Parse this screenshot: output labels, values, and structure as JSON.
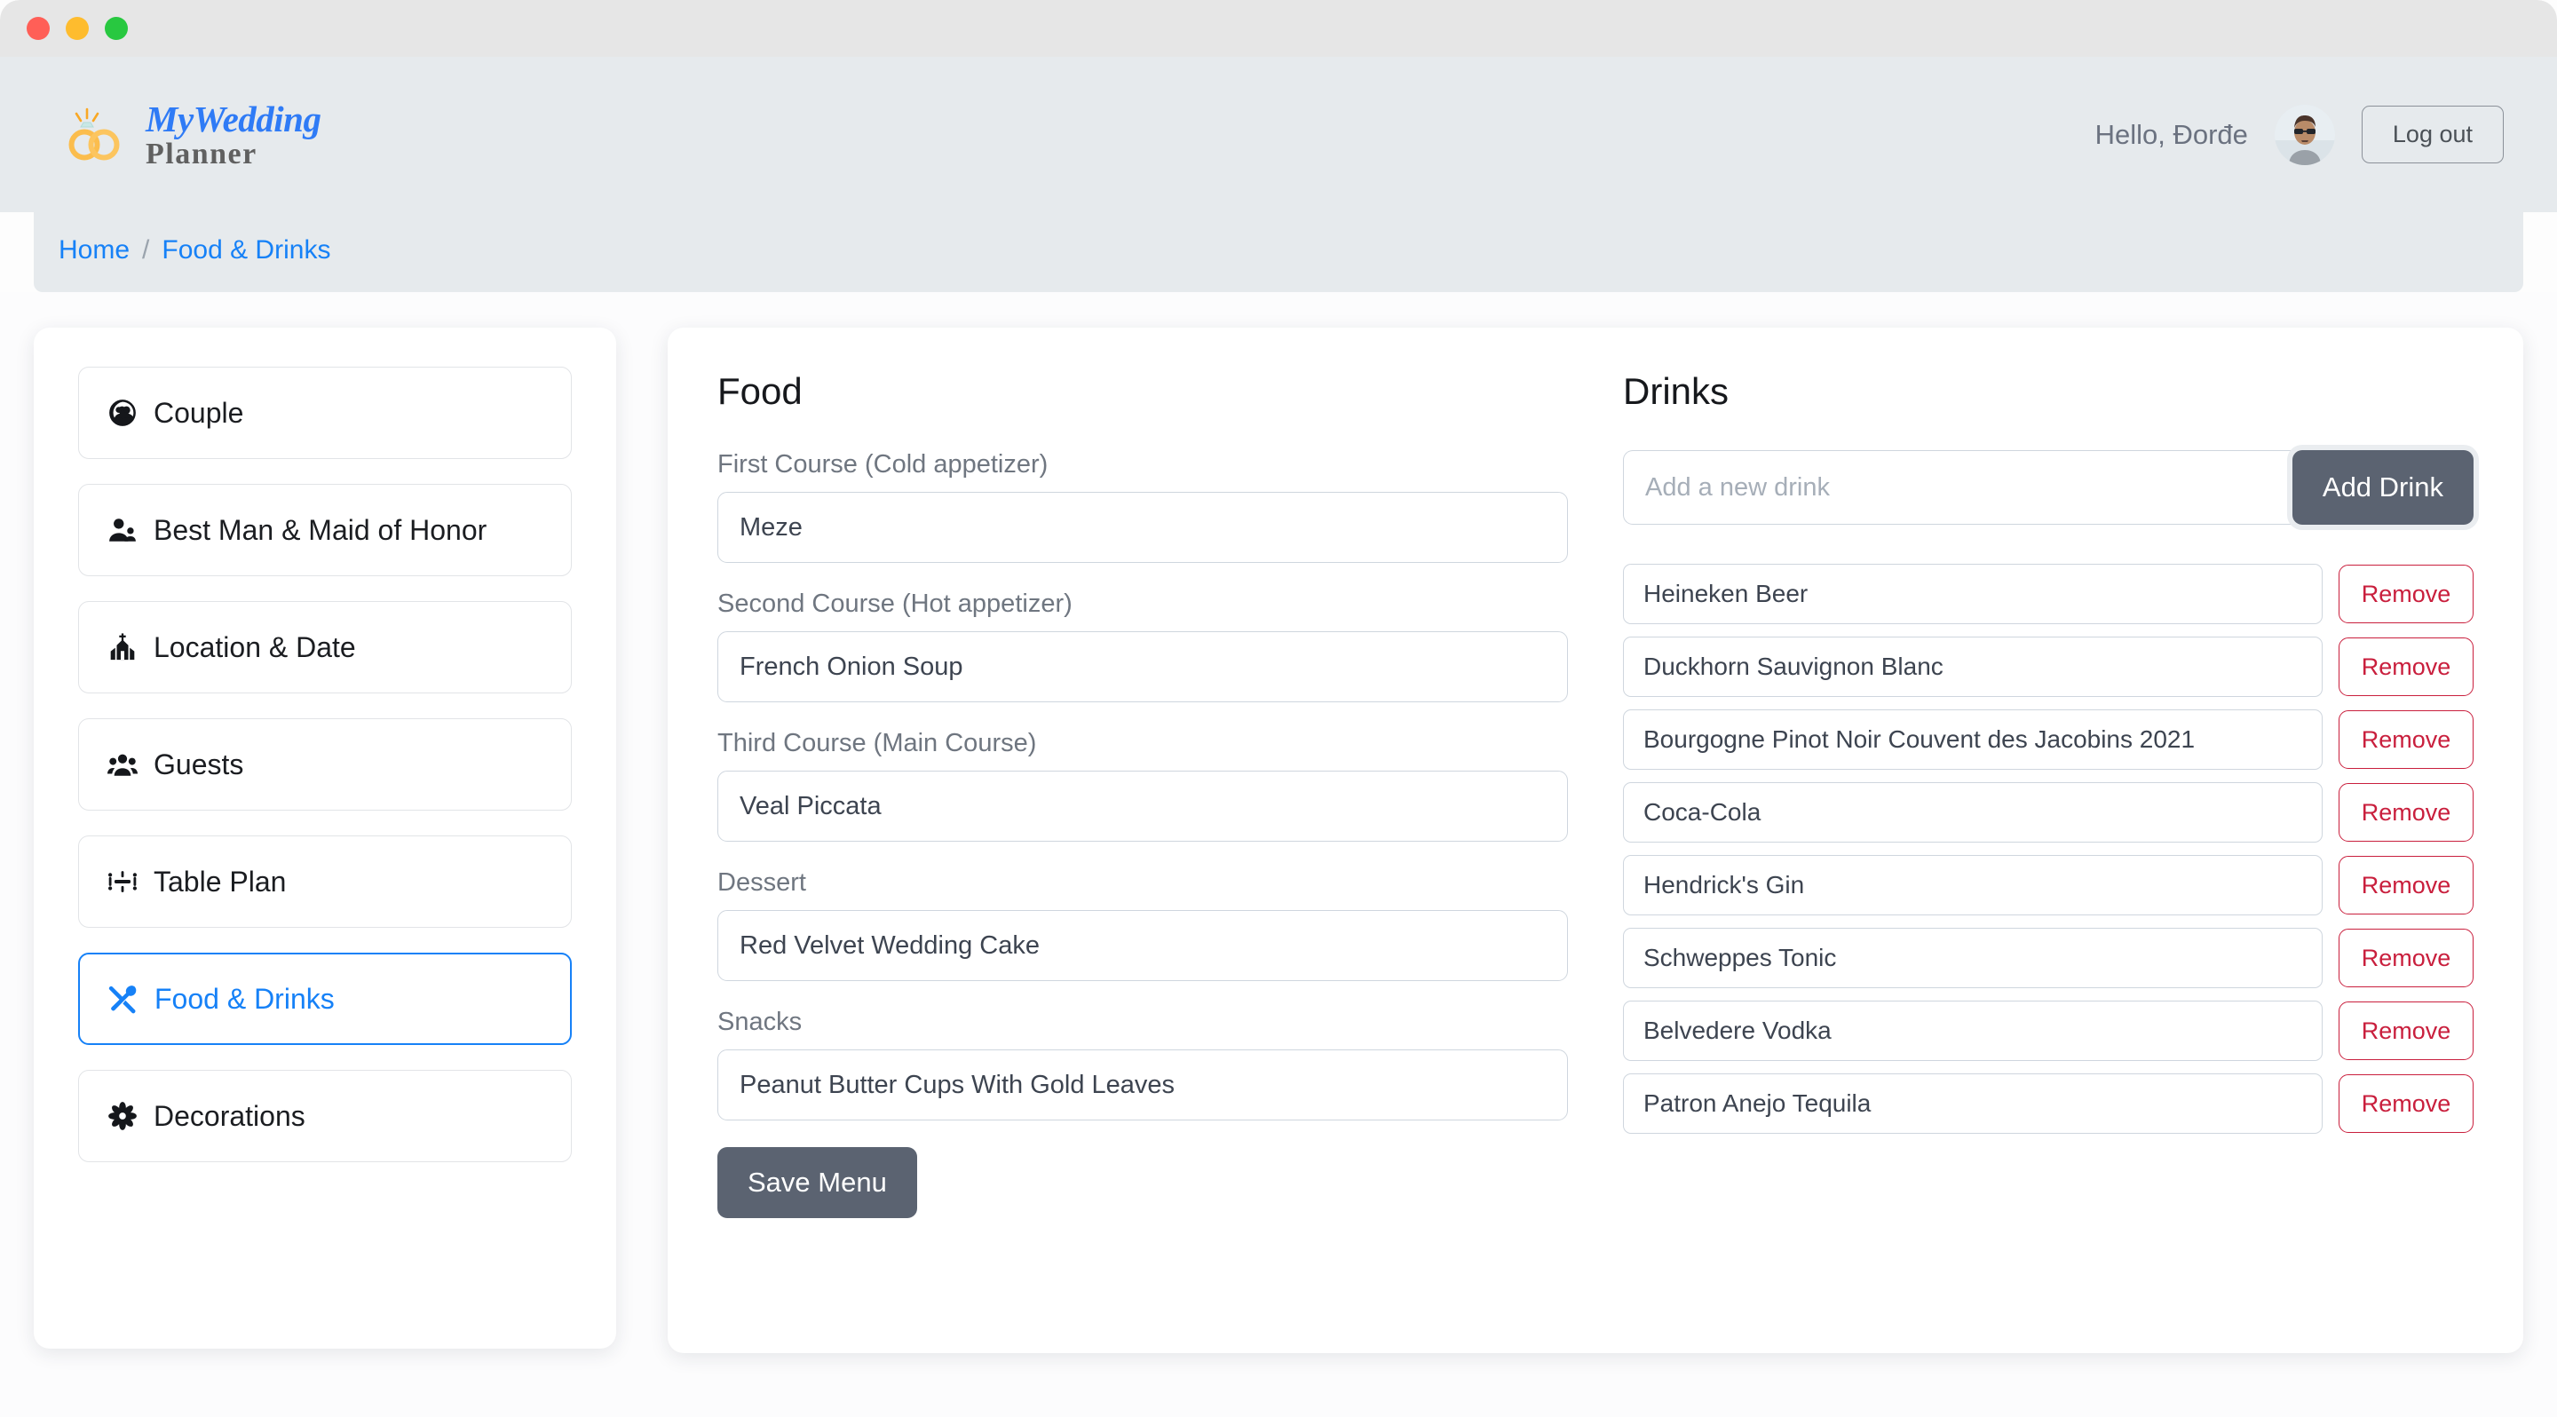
{
  "window": {
    "traffic_lights": [
      "close",
      "minimize",
      "zoom"
    ]
  },
  "header": {
    "brand_top": "MyWedding",
    "brand_bottom": "Planner",
    "greeting": "Hello, Đorđe",
    "logout_label": "Log out",
    "brand_blue": "#2f7bf6",
    "brand_gray": "#606060",
    "ring_gold": "#f9b949"
  },
  "breadcrumb": {
    "home": "Home",
    "separator": "/",
    "current": "Food & Drinks",
    "link_color": "#1681f7"
  },
  "sidebar": {
    "items": [
      {
        "label": "Couple",
        "icon": "couple-icon",
        "active": false
      },
      {
        "label": "Best Man & Maid of Honor",
        "icon": "person-add-icon",
        "active": false
      },
      {
        "label": "Location & Date",
        "icon": "church-icon",
        "active": false
      },
      {
        "label": "Guests",
        "icon": "people-group-icon",
        "active": false
      },
      {
        "label": "Table Plan",
        "icon": "table-plan-icon",
        "active": false
      },
      {
        "label": "Food & Drinks",
        "icon": "fork-spoon-icon",
        "active": true
      },
      {
        "label": "Decorations",
        "icon": "flower-icon",
        "active": false
      }
    ],
    "active_color": "#1681f7"
  },
  "food": {
    "title": "Food",
    "fields": [
      {
        "label": "First Course (Cold appetizer)",
        "value": "Meze"
      },
      {
        "label": "Second Course (Hot appetizer)",
        "value": "French Onion Soup"
      },
      {
        "label": "Third Course (Main Course)",
        "value": "Veal Piccata"
      },
      {
        "label": "Dessert",
        "value": "Red Velvet Wedding Cake"
      },
      {
        "label": "Snacks",
        "value": "Peanut Butter Cups With Gold Leaves"
      }
    ],
    "save_label": "Save Menu"
  },
  "drinks": {
    "title": "Drinks",
    "new_drink_value": "",
    "new_drink_placeholder": "Add a new drink",
    "add_label": "Add Drink",
    "remove_label": "Remove",
    "remove_color": "#c91f3d",
    "items": [
      "Heineken Beer",
      "Duckhorn Sauvignon Blanc",
      "Bourgogne Pinot Noir Couvent des Jacobins 2021",
      "Coca-Cola",
      "Hendrick's Gin",
      "Schweppes Tonic",
      "Belvedere Vodka",
      "Patron Anejo Tequila"
    ]
  }
}
